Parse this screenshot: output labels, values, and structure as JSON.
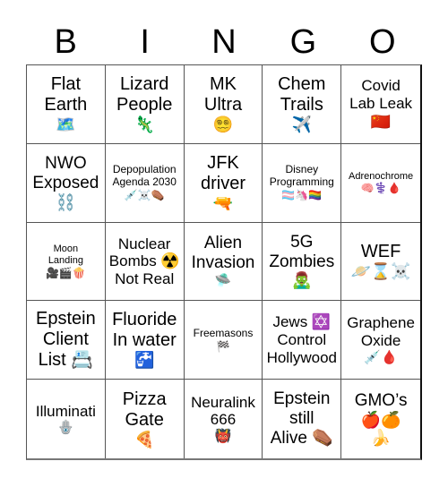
{
  "header": {
    "letters": [
      "B",
      "I",
      "N",
      "G",
      "O"
    ]
  },
  "cells": [
    {
      "text": "Flat\nEarth",
      "icons": "🗺️",
      "icon_names": [
        "world-map-icon"
      ]
    },
    {
      "text": "Lizard\nPeople",
      "icons": "🦎",
      "icon_names": [
        "lizard-icon"
      ]
    },
    {
      "text": "MK\nUltra",
      "icons": "😵‍💫",
      "icon_names": [
        "dizzy-face-icon"
      ]
    },
    {
      "text": "Chem\nTrails",
      "icons": "✈️",
      "icon_names": [
        "airplane-icon"
      ]
    },
    {
      "text": "Covid\nLab Leak",
      "icons": "🇨🇳",
      "icon_names": [
        "china-flag-icon"
      ]
    },
    {
      "text": "NWO\nExposed",
      "icons": "⛓️",
      "icon_names": [
        "chains-icon"
      ]
    },
    {
      "text": "Depopulation\nAgenda 2030",
      "icons": "💉☠️⚰️",
      "icon_names": [
        "syringe-icon",
        "skull-crossbones-icon",
        "coffin-icon"
      ]
    },
    {
      "text": "JFK\ndriver",
      "icons": "🔫",
      "icon_names": [
        "water-pistol-icon"
      ]
    },
    {
      "text": "Disney\nProgramming",
      "icons": "🏳️‍⚧️🦄🏳️‍🌈",
      "icon_names": [
        "transgender-flag-icon",
        "unicorn-icon",
        "rainbow-flag-icon"
      ]
    },
    {
      "text": "Adrenochrome",
      "icons": "🧠⚕️🩸",
      "icon_names": [
        "brain-icon",
        "medical-symbol-icon",
        "blood-drop-icon"
      ]
    },
    {
      "text": "Moon\nLanding",
      "icons": "🎥🎬🍿",
      "icon_names": [
        "movie-camera-icon",
        "clapper-board-icon",
        "popcorn-icon"
      ]
    },
    {
      "text": "Nuclear\nBombs ☢️\nNot Real",
      "icons": "",
      "icon_names": [
        "radioactive-icon"
      ]
    },
    {
      "text": "Alien\nInvasion",
      "icons": "🛸",
      "icon_names": [
        "ufo-icon"
      ]
    },
    {
      "text": "5G\nZombies",
      "icons": "🧟‍♂️",
      "icon_names": [
        "zombie-icon"
      ]
    },
    {
      "text": "WEF",
      "icons": "🪐⌛☠️",
      "icon_names": [
        "ringed-planet-icon",
        "hourglass-icon",
        "skull-crossbones-icon"
      ]
    },
    {
      "text": "Epstein\nClient\nList 📇",
      "icons": "",
      "icon_names": [
        "card-index-icon"
      ]
    },
    {
      "text": "Fluoride\nIn water",
      "icons": "🚰",
      "icon_names": [
        "potable-water-icon"
      ]
    },
    {
      "text": "Freemasons",
      "icons": "🏁",
      "icon_names": [
        "checkered-flag-icon"
      ]
    },
    {
      "text": "Jews ✡️\nControl\nHollywood",
      "icons": "",
      "icon_names": [
        "star-of-david-icon"
      ]
    },
    {
      "text": "Graphene\nOxide",
      "icons": "💉🩸",
      "icon_names": [
        "syringe-icon",
        "blood-drop-icon"
      ]
    },
    {
      "text": "Illuminati",
      "icons": "🪬",
      "icon_names": [
        "hamsa-icon"
      ]
    },
    {
      "text": "Pizza\nGate",
      "icons": "🍕",
      "icon_names": [
        "pizza-icon"
      ]
    },
    {
      "text": "Neuralink\n666",
      "icons": "👹",
      "icon_names": [
        "ogre-icon"
      ]
    },
    {
      "text": "Epstein\nstill\nAlive ⚰️",
      "icons": "",
      "icon_names": [
        "coffin-icon"
      ]
    },
    {
      "text": "GMO’s",
      "icons": "🍎🍊\n🍌",
      "icon_names": [
        "apple-icon",
        "tangerine-icon",
        "banana-icon"
      ]
    }
  ]
}
